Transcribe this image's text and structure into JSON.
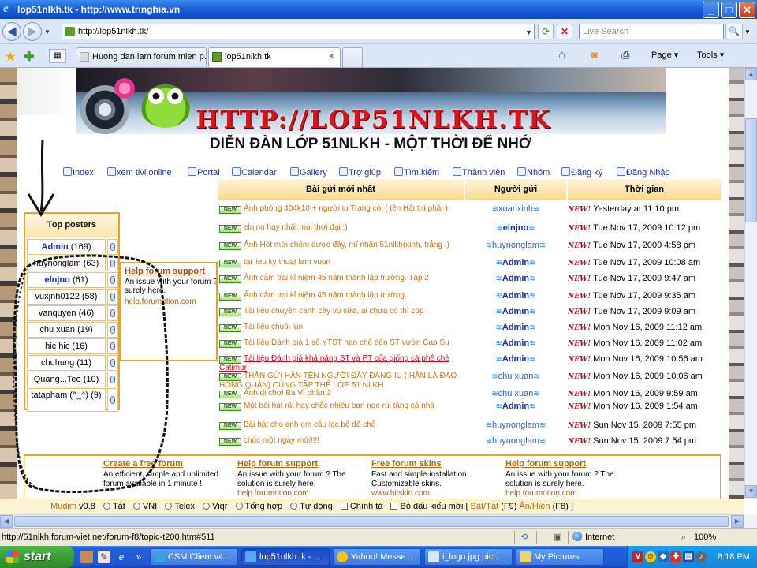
{
  "window": {
    "title": "lop51nlkh.tk - http://www.tringhia.vn",
    "minimize": "_",
    "maximize": "□",
    "close": "✕"
  },
  "address_bar": {
    "url": "http://lop51nlkh.tk/",
    "search_placeholder": "Live Search"
  },
  "tabs": [
    {
      "label": "Huong dan lam forum mien p..."
    },
    {
      "label": "lop51nlkh.tk",
      "close": "✕"
    }
  ],
  "command_bar": {
    "page": "Page ▾",
    "tools": "Tools ▾"
  },
  "page": {
    "banner_url": "HTTP://LOP51NLKH.TK",
    "forum_title": "DIỄN ĐÀN LỚP 51NLKH - MỘT THỜI ĐỂ NHỚ",
    "nav": [
      "Index",
      "xem tivi online",
      "Portal",
      "Calendar",
      "Gallery",
      "Trợ giúp",
      "Tìm kiếm",
      "Thành viên",
      "Nhóm",
      "Đăng ký",
      "Đăng Nhập"
    ]
  },
  "top_posters": {
    "title": "Top posters",
    "rows": [
      {
        "name": "Admin",
        "count": "(169)"
      },
      {
        "name": "huynonglam",
        "count": "(63)"
      },
      {
        "name": "elnjno",
        "count": "(61)"
      },
      {
        "name": "vuxjnh0122",
        "count": "(58)"
      },
      {
        "name": "vanquyen",
        "count": "(46)"
      },
      {
        "name": "chu xuan",
        "count": "(19)"
      },
      {
        "name": "hic hic",
        "count": "(16)"
      },
      {
        "name": "chuhung",
        "count": "(11)"
      },
      {
        "name": "Quang...Teo",
        "count": "(10)"
      },
      {
        "name": "tatapham (^_^)",
        "count": "(9)"
      }
    ]
  },
  "help_popup": {
    "link": "Help forum support",
    "text": "An issue with your forum ? The solution is surely here.",
    "url": "help.forumotion.com"
  },
  "latest_posts": {
    "headers": [
      "Bài gửi mới nhất",
      "Người gửi",
      "Thời gian"
    ],
    "rows": [
      {
        "topic": "Ảnh phòng 404k10 + người iu Trang còi ( tên Hải thì phải )",
        "poster": "xuanxinh",
        "time": "Yesterday at 11:10 pm"
      },
      {
        "topic": "elnjno hay nhất mọi thời đại :)",
        "poster": "elnjno",
        "time": "Tue Nov 17, 2009 10:12 pm"
      },
      {
        "topic": "Ảnh Hót mới chôm được đây, mĩ nhân 51nlkh(xinh, trắng :)",
        "poster": "huynonglam",
        "time": "Tue Nov 17, 2009 4:58 pm"
      },
      {
        "topic": "tai lieu ky thuat lam vuon",
        "poster": "Admin",
        "time": "Tue Nov 17, 2009 10:08 am"
      },
      {
        "topic": "Ảnh cắm trại kỉ niệm 45 năm thành lập trường. Tập 2",
        "poster": "Admin",
        "time": "Tue Nov 17, 2009 9:47 am"
      },
      {
        "topic": "Ảnh cắm trại kỉ niệm 45 năm thành lập trường.",
        "poster": "Admin",
        "time": "Tue Nov 17, 2009 9:35 am"
      },
      {
        "topic": "Tài liệu chuyên canh cây vú sữa, ai chưa có thì cop",
        "poster": "Admin",
        "time": "Tue Nov 17, 2009 9:09 am"
      },
      {
        "topic": "Tài liệu chuối lùn",
        "poster": "Admin",
        "time": "Mon Nov 16, 2009 11:12 am"
      },
      {
        "topic": "Tài liệu Đánh giá 1 số YTST hạn chế đến ST vườn Cao Su",
        "poster": "Admin",
        "time": "Mon Nov 16, 2009 11:02 am"
      },
      {
        "topic": "Tài liệu Đánh giá khả năng ST và PT của giống cà phê chè Catimor",
        "poster": "Admin",
        "time": "Mon Nov 16, 2009 10:56 am"
      },
      {
        "topic": "THÂN GỬI HẬN TÊN NGƯỜI ĐẦY ĐÁNG IU ( HẬN LÀ ĐÀO HỒNG QUÂN) CÙNG TẬP THỂ LỚP 51 NLKH",
        "poster": "chu xuan",
        "time": "Mon Nov 16, 2009 10:06 am"
      },
      {
        "topic": "Ảnh đi chơi Ba Vì phần 2",
        "poster": "chu xuan",
        "time": "Mon Nov 16, 2009 9:59 am"
      },
      {
        "topic": "Một bài hát rất hay chắc nhiều bạn nge rùi tặng cả nhà",
        "poster": "Admin",
        "time": "Mon Nov 16, 2009 1:54 am"
      },
      {
        "topic": "Bài hát cho anh em câu lạc bộ đế chế",
        "poster": "huynonglam",
        "time": "Sun Nov 15, 2009 7:55 pm"
      },
      {
        "topic": "chúc một ngày mới!!!!",
        "poster": "huynonglam",
        "time": "Sun Nov 15, 2009 7:54 pm"
      }
    ],
    "new_label": "NEW",
    "time_badge": "NEW!"
  },
  "footer": [
    {
      "link": "Create a free forum",
      "desc": "An efficient, simple and unlimited forum available in 1 minute !",
      "url": ""
    },
    {
      "link": "Help forum support",
      "desc": "An issue with your forum ? The solution is surely here.",
      "url": "help.forumotion.com"
    },
    {
      "link": "Free forum skins",
      "desc": "Fast and simple installation. Customizable skins.",
      "url": "www.hitskin.com"
    },
    {
      "link": "Help forum support",
      "desc": "An issue with your forum ? The solution is surely here.",
      "url": "help.forumotion.com"
    }
  ],
  "mudim": {
    "name": "Mudim",
    "version": "v0.8",
    "options": [
      "Tắt",
      "VNI",
      "Telex",
      "Viqr",
      "Tổng hợp",
      "Tự động"
    ],
    "checks": [
      "Chính tả",
      "Bỏ dấu kiểu mới"
    ],
    "open_bracket": "[",
    "toggle": "Bật/Tắt",
    "toggle_key": "(F9)",
    "hide": "Ẩn/Hiện",
    "hide_key": "(F8)",
    "close_bracket": "]"
  },
  "status_bar": {
    "url": "http://51nlkh.forum-viet.net/forum-f8/topic-t200.htm#511",
    "zone": "Internet",
    "zoom": "100%"
  },
  "taskbar": {
    "start": "start",
    "tasks": [
      "CSM Client v4....",
      "lop51nlkh.tk - ...",
      "Yahoo! Messe...",
      "i_logo.jpg pict...",
      "My Pictures"
    ],
    "clock": "8:18 PM"
  }
}
